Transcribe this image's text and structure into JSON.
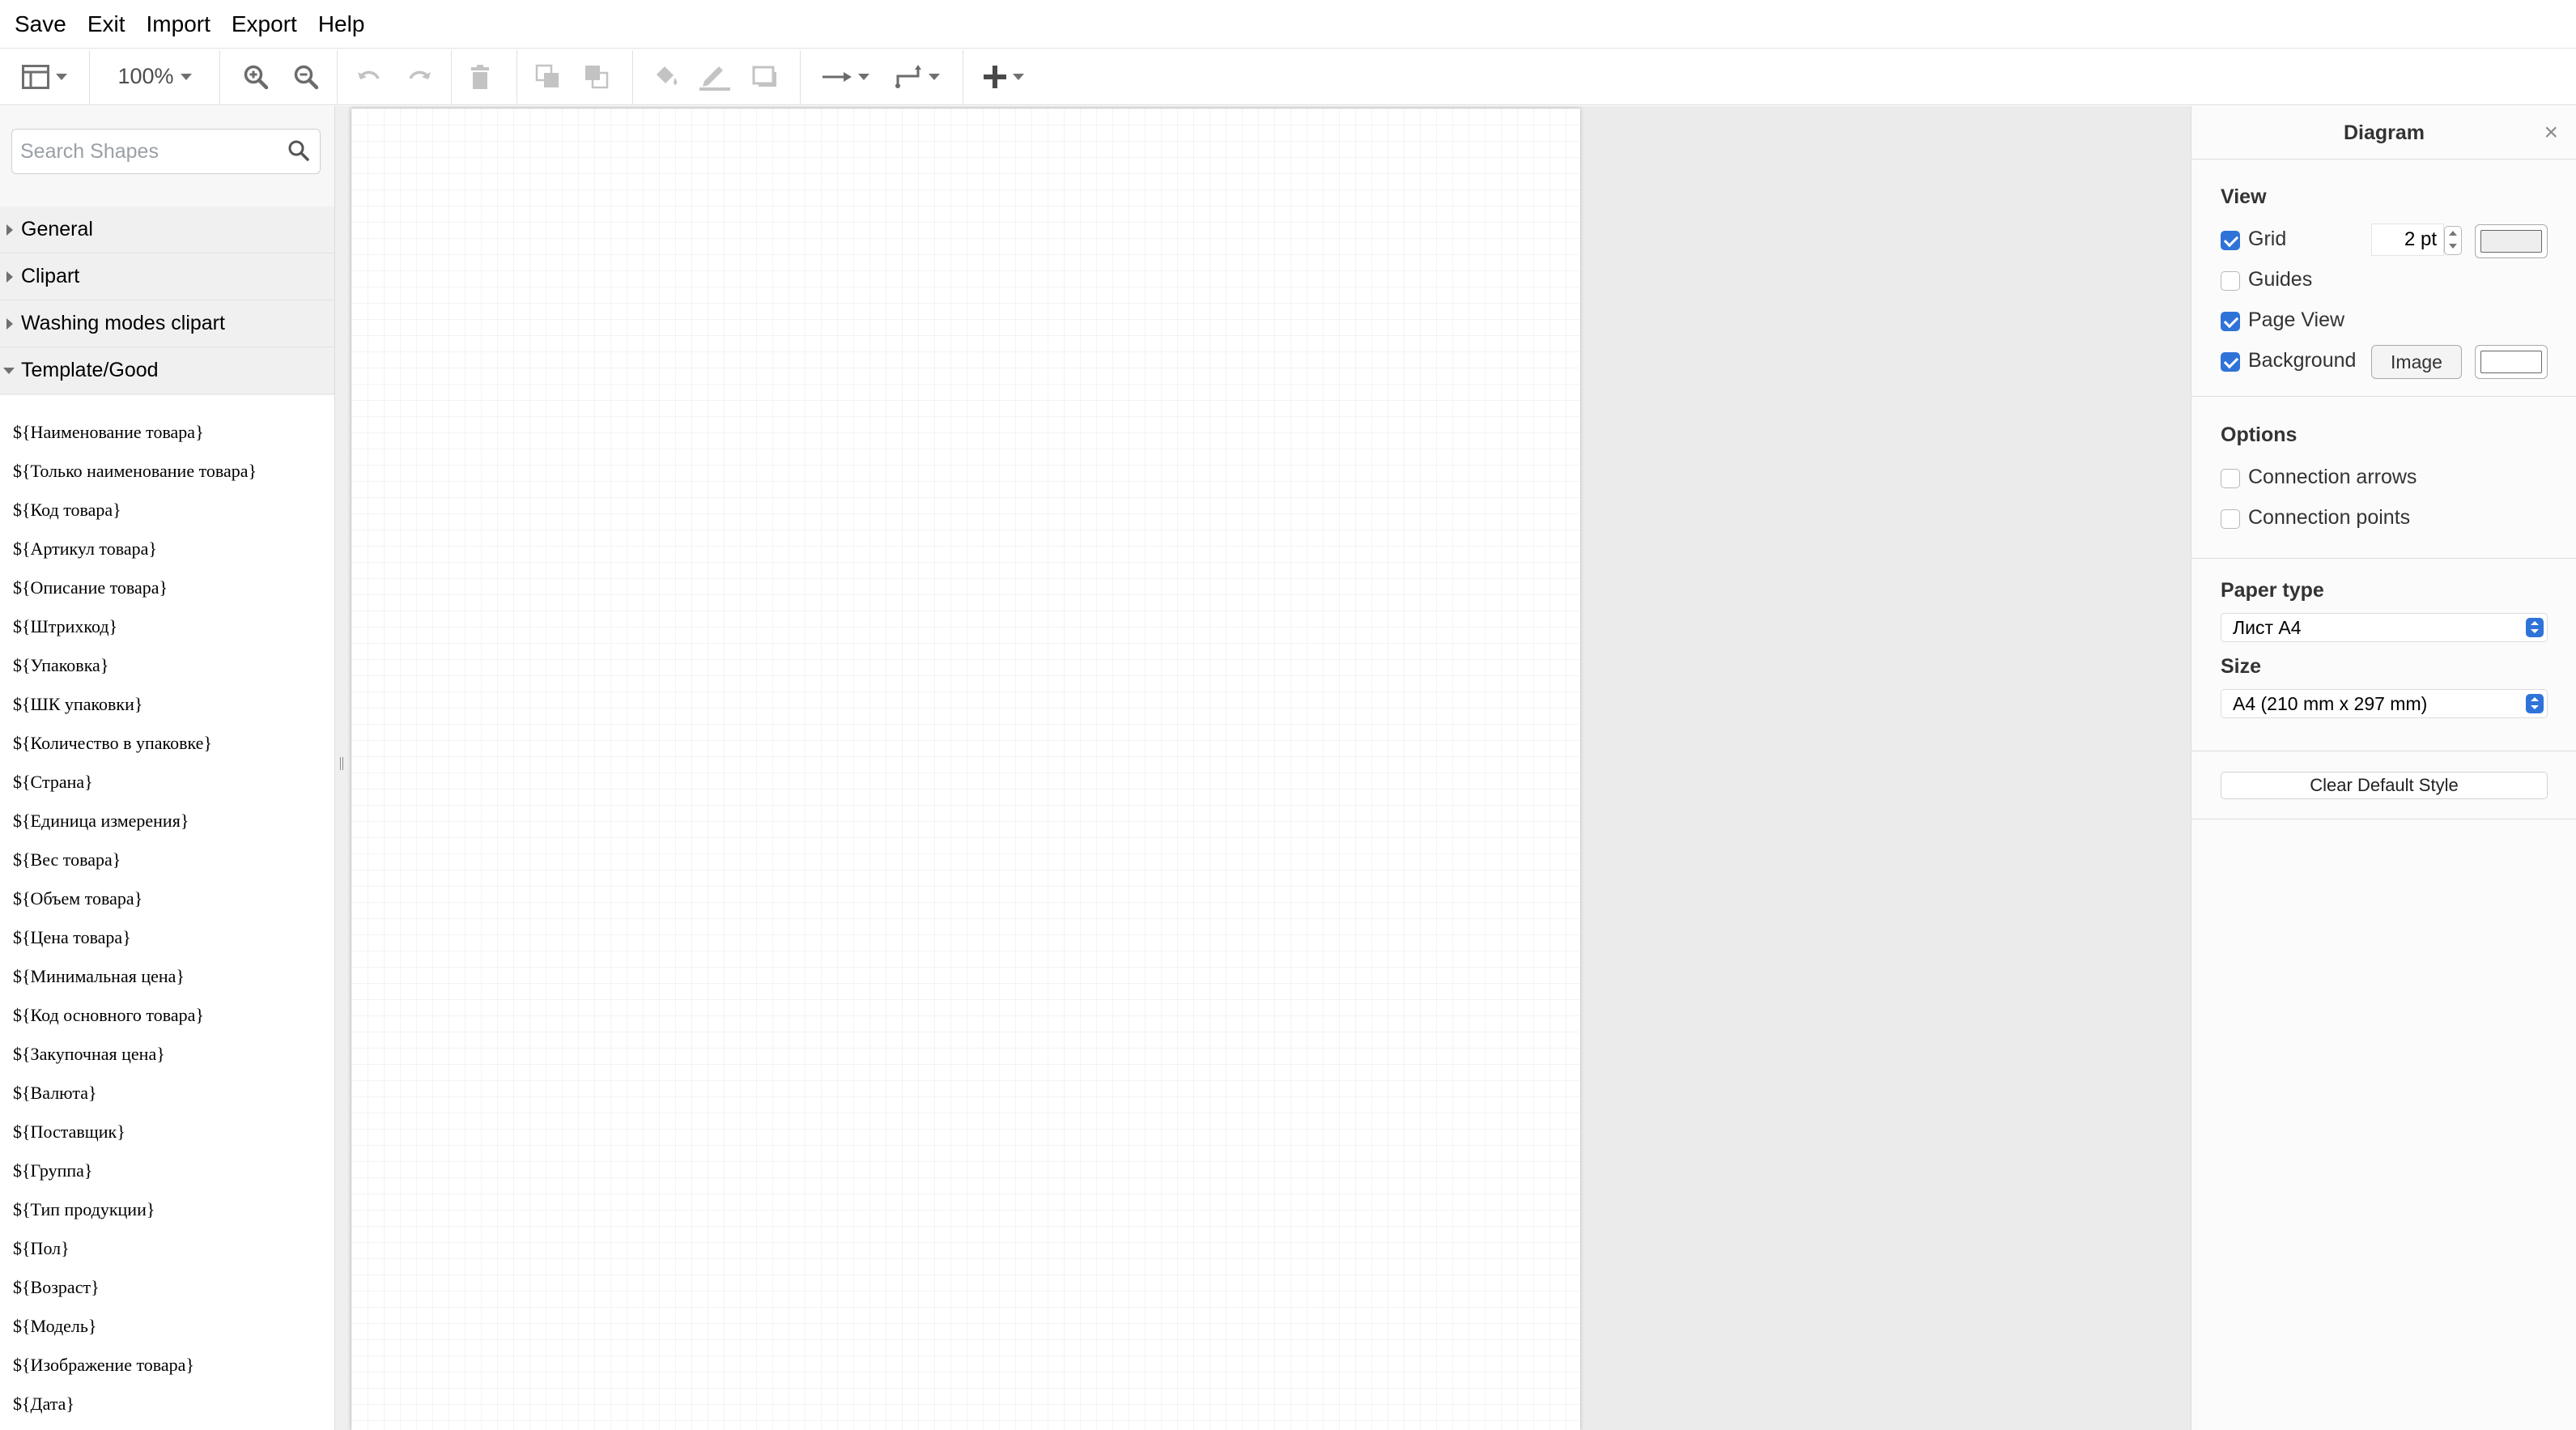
{
  "menu": [
    "Save",
    "Exit",
    "Import",
    "Export",
    "Help"
  ],
  "toolbar": {
    "zoom": "100%",
    "icons": [
      "format-panel-icon",
      "zoom-in-icon",
      "zoom-out-icon",
      "undo-icon",
      "redo-icon",
      "delete-icon",
      "to-front-icon",
      "to-back-icon",
      "fill-color-icon",
      "line-color-icon",
      "shadow-icon",
      "connection-icon",
      "waypoints-icon",
      "insert-icon"
    ]
  },
  "sidebar": {
    "search_placeholder": "Search Shapes",
    "categories": [
      {
        "label": "General",
        "expanded": false
      },
      {
        "label": "Clipart",
        "expanded": false
      },
      {
        "label": "Washing modes clipart",
        "expanded": false
      },
      {
        "label": "Template/Good",
        "expanded": true
      }
    ],
    "shapes": [
      "${Наименование товара}",
      "${Только наименование товара}",
      "${Код товара}",
      "${Артикул товара}",
      "${Описание товара}",
      "${Штрихкод}",
      "${Упаковка}",
      "${ШК упаковки}",
      "${Количество в упаковке}",
      "${Страна}",
      "${Единица измерения}",
      "${Вес товара}",
      "${Объем товара}",
      "${Цена товара}",
      "${Минимальная цена}",
      "${Код основного товара}",
      "${Закупочная цена}",
      "${Валюта}",
      "${Поставщик}",
      "${Группа}",
      "${Тип продукции}",
      "${Пол}",
      "${Возраст}",
      "${Модель}",
      "${Изображение товара}",
      "${Дата}"
    ]
  },
  "panel": {
    "title": "Diagram",
    "close": "×",
    "view_title": "View",
    "grid_label": "Grid",
    "grid_checked": true,
    "grid_size": "2 pt",
    "guides_label": "Guides",
    "guides_checked": false,
    "page_view_label": "Page View",
    "page_view_checked": true,
    "background_label": "Background",
    "background_checked": true,
    "image_button": "Image",
    "options_title": "Options",
    "connection_arrows_label": "Connection arrows",
    "connection_arrows_checked": false,
    "connection_points_label": "Connection points",
    "connection_points_checked": false,
    "paper_type_title": "Paper type",
    "paper_type_value": "Лист A4",
    "size_title": "Size",
    "size_value": "A4 (210 mm x 297 mm)",
    "clear_default_style": "Clear Default Style"
  },
  "colors": {
    "accent": "#2f73d8",
    "canvas_bg": "#ebebeb",
    "sidebar_bg": "#f7f7f7"
  }
}
